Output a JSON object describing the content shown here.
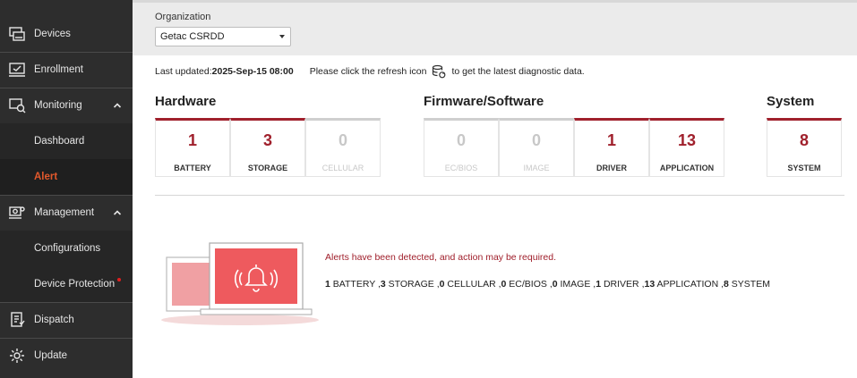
{
  "sidebar": {
    "items": [
      {
        "label": "Devices",
        "icon": "devices-icon"
      },
      {
        "label": "Enrollment",
        "icon": "enrollment-icon"
      },
      {
        "label": "Monitoring",
        "icon": "monitoring-icon",
        "expanded": true
      },
      {
        "label": "Dashboard"
      },
      {
        "label": "Alert",
        "active": true
      },
      {
        "label": "Management",
        "icon": "management-icon",
        "expanded": true
      },
      {
        "label": "Configurations"
      },
      {
        "label": "Device Protection",
        "badge": "red-dot"
      },
      {
        "label": "Dispatch",
        "icon": "dispatch-icon"
      },
      {
        "label": "Update",
        "icon": "update-icon"
      }
    ]
  },
  "org": {
    "label": "Organization",
    "selected": "Getac CSRDD"
  },
  "status": {
    "updated_prefix": "Last updated:",
    "updated_value": "2025-Sep-15 08:00",
    "hint_before": "Please click the refresh icon",
    "hint_after": "to get the latest diagnostic data."
  },
  "sections": {
    "hardware": {
      "title": "Hardware",
      "cards": [
        {
          "value": "1",
          "label": "BATTERY"
        },
        {
          "value": "3",
          "label": "STORAGE"
        },
        {
          "value": "0",
          "label": "CELLULAR"
        }
      ]
    },
    "firmware": {
      "title": "Firmware/Software",
      "cards": [
        {
          "value": "0",
          "label": "EC/BIOS"
        },
        {
          "value": "0",
          "label": "IMAGE"
        },
        {
          "value": "1",
          "label": "DRIVER"
        },
        {
          "value": "13",
          "label": "APPLICATION"
        }
      ]
    },
    "system": {
      "title": "System",
      "cards": [
        {
          "value": "8",
          "label": "SYSTEM"
        }
      ]
    }
  },
  "alert": {
    "message": "Alerts have been detected, and action may be required.",
    "summary": [
      {
        "count": "1",
        "label": "BATTERY"
      },
      {
        "count": "3",
        "label": "STORAGE"
      },
      {
        "count": "0",
        "label": "CELLULAR"
      },
      {
        "count": "0",
        "label": "EC/BIOS"
      },
      {
        "count": "0",
        "label": "IMAGE"
      },
      {
        "count": "1",
        "label": "DRIVER"
      },
      {
        "count": "13",
        "label": "APPLICATION"
      },
      {
        "count": "8",
        "label": "SYSTEM"
      }
    ]
  },
  "colors": {
    "accent_red": "#a0202c",
    "active_nav": "#e2582c",
    "sidebar_bg": "#2d2d2d"
  }
}
